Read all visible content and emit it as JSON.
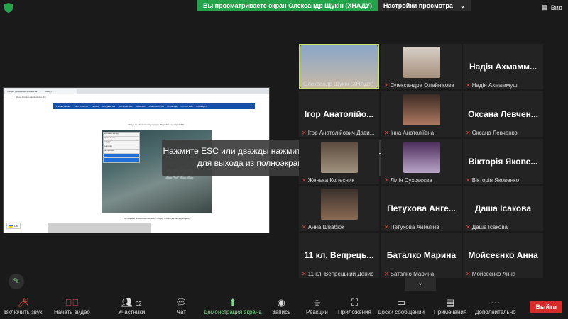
{
  "banner": {
    "text": "Вы просматриваете экран Олександр Щукін (ХНАДУ)",
    "options": "Настройки просмотра"
  },
  "view_label": "Вид",
  "browser": {
    "tab1": "ХНАДУ | www.khadi.kharkov.ua",
    "tab2": "ХНАДУ",
    "url": "khadi.kharkov.ua/site/index.php",
    "nav": [
      "УНІВЕРСИТЕТ",
      "АБІТУРІЄНТУ",
      "НАУКА",
      "СТУДЕНТАМ",
      "АСПІРАНТАМ",
      "НОВИНИ",
      "СПИСОК ГРУП",
      "РОЗКЛАД",
      "СТРУКТУРА",
      "КАФЕДРИ"
    ]
  },
  "shared": {
    "caption_top": "3D тур по Механічному корпусу (Розробка кафедри ЕТБ)",
    "caption_bottom": "3D модель Механічного корпусу ХНАДУ (Розробка кафедри БДМ)",
    "big_num": "2022",
    "menu": [
      "Загальний вигляд",
      "Головний хол",
      "Коридор",
      "Аудиторія",
      "Лабораторія"
    ],
    "lang": "UK"
  },
  "toast": {
    "line1": "Нажмите ESC или дважды нажмите левую кнопку мыши",
    "line2": "для выхода из полноэкранного режима"
  },
  "participants": [
    {
      "name": "",
      "label": "Олександр Щукін (ХНАДУ)",
      "active": true
    },
    {
      "name": "",
      "label": "Олександра Олейнікова"
    },
    {
      "name": "Надія Ахмамм...",
      "label": "Надія Ахмаммуш"
    },
    {
      "name": "Ігор Анатолійо...",
      "label": "Ігор Анатолійович Дави..."
    },
    {
      "name": "",
      "label": "Інна Анатоліївна"
    },
    {
      "name": "Оксана Левчен...",
      "label": "Оксана Левченко"
    },
    {
      "name": "",
      "label": "Женька Колесник"
    },
    {
      "name": "",
      "label": "Лілія Сухоєєєва"
    },
    {
      "name": "Вікторія Якове...",
      "label": "Вікторія Яковенко"
    },
    {
      "name": "",
      "label": "Анна Швабюк"
    },
    {
      "name": "Петухова Анге...",
      "label": "Петухова Ангеліна"
    },
    {
      "name": "Даша Ісакова",
      "label": "Даша Ісакова"
    },
    {
      "name": "11 кл, Вепрець...",
      "label": "11 кл, Вепрецький Денис"
    },
    {
      "name": "Баталко Марина",
      "label": "Баталко Марина"
    },
    {
      "name": "Мойсеєнко Анна",
      "label": "Мойсеєнко Анна"
    }
  ],
  "toolbar": {
    "mute": "Включить звук",
    "video": "Начать видео",
    "participants": "Участники",
    "participants_count": "62",
    "chat": "Чат",
    "share": "Демонстрация экрана",
    "record": "Запись",
    "reactions": "Реакции",
    "apps": "Приложения",
    "whiteboards": "Доски сообщений",
    "notes": "Примечания",
    "more": "Дополнительно",
    "leave": "Выйти"
  },
  "colors": {
    "accent_green": "#23a34a",
    "leave_red": "#d62b2b",
    "active_border": "#c8e06e"
  }
}
